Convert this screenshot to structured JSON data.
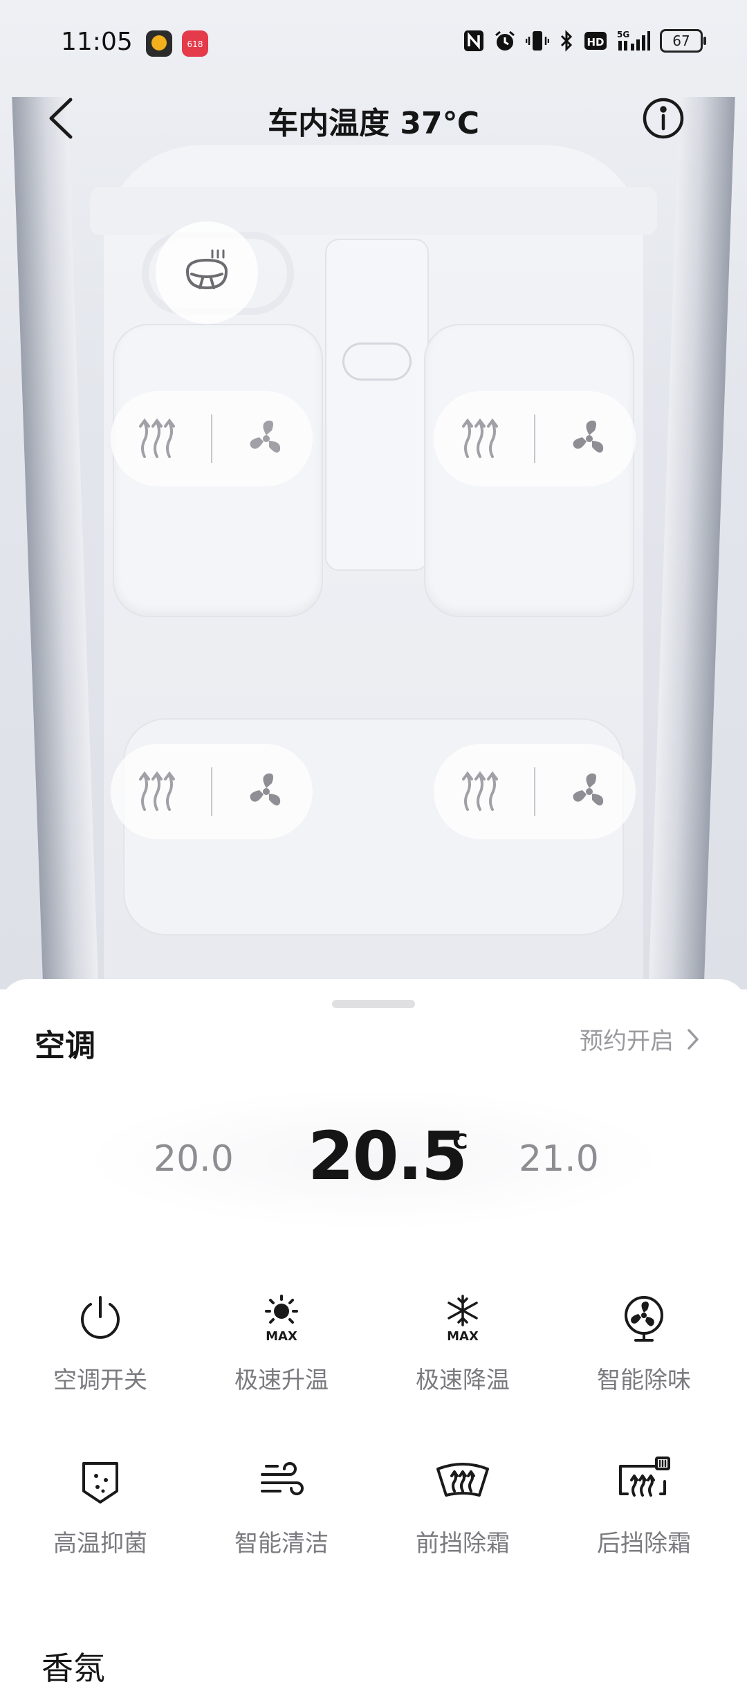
{
  "status_bar": {
    "time": "11:05",
    "app_badge": "618",
    "network": "5G",
    "hd": "HD",
    "battery": "67"
  },
  "header": {
    "title": "车内温度 37℃"
  },
  "climate": {
    "section_title": "空调",
    "schedule_label": "预约开启",
    "temp_prev": "20.0",
    "temp_current": "20.5",
    "temp_unit": "℃",
    "temp_next": "21.0"
  },
  "functions": [
    {
      "label": "空调开关",
      "icon": "power-icon"
    },
    {
      "label": "极速升温",
      "icon": "sun-max-icon"
    },
    {
      "label": "极速降温",
      "icon": "snowflake-max-icon"
    },
    {
      "label": "智能除味",
      "icon": "fan-circle-icon"
    },
    {
      "label": "高温抑菌",
      "icon": "shield-dots-icon"
    },
    {
      "label": "智能清洁",
      "icon": "wind-icon"
    },
    {
      "label": "前挡除霜",
      "icon": "front-defrost-icon"
    },
    {
      "label": "后挡除霜",
      "icon": "rear-defrost-icon"
    }
  ],
  "next_section": {
    "title": "香氛"
  }
}
